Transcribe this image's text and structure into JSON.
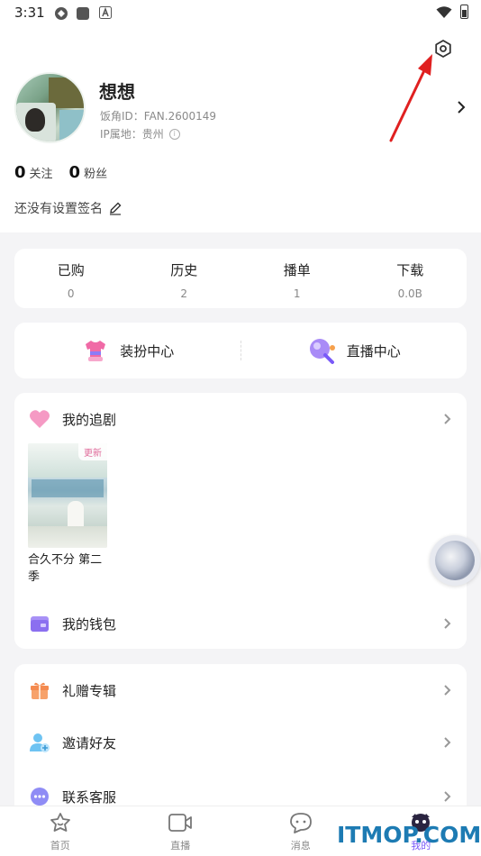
{
  "status_bar": {
    "time": "3:31",
    "icons": [
      "sync-icon",
      "square-icon",
      "a-box-icon",
      "wifi-icon",
      "battery-icon"
    ]
  },
  "profile": {
    "nickname": "想想",
    "id_label": "饭角ID：",
    "id_value": "FAN.2600149",
    "ip_label": "IP属地：",
    "ip_value": "贵州",
    "following_count": "0",
    "following_label": "关注",
    "fans_count": "0",
    "fans_label": "粉丝",
    "signature": "还没有设置签名"
  },
  "stats": [
    {
      "label": "已购",
      "value": "0"
    },
    {
      "label": "历史",
      "value": "2"
    },
    {
      "label": "播单",
      "value": "1"
    },
    {
      "label": "下载",
      "value": "0.0B"
    }
  ],
  "centers": [
    {
      "label": "装扮中心",
      "icon": "dress-up-icon"
    },
    {
      "label": "直播中心",
      "icon": "live-center-icon"
    }
  ],
  "follow_section": {
    "title": "我的追剧",
    "items": [
      {
        "title": "合久不分 第二季",
        "badge": "更新"
      }
    ]
  },
  "wallet": {
    "label": "我的钱包"
  },
  "more_list": [
    {
      "label": "礼赠专辑",
      "icon": "gift-icon"
    },
    {
      "label": "邀请好友",
      "icon": "invite-user-icon"
    },
    {
      "label": "联系客服",
      "icon": "chat-service-icon"
    }
  ],
  "tabs": [
    {
      "label": "首页",
      "icon": "home-icon"
    },
    {
      "label": "直播",
      "icon": "live-video-icon"
    },
    {
      "label": "消息",
      "icon": "message-icon"
    },
    {
      "label": "我的",
      "icon": "profile-icon"
    }
  ],
  "active_tab": "我的",
  "watermark": "ITMOP.COM",
  "colors": {
    "accent": "#7a5af8",
    "annotation_arrow": "#e02020",
    "watermark": "#1d7bb3"
  }
}
